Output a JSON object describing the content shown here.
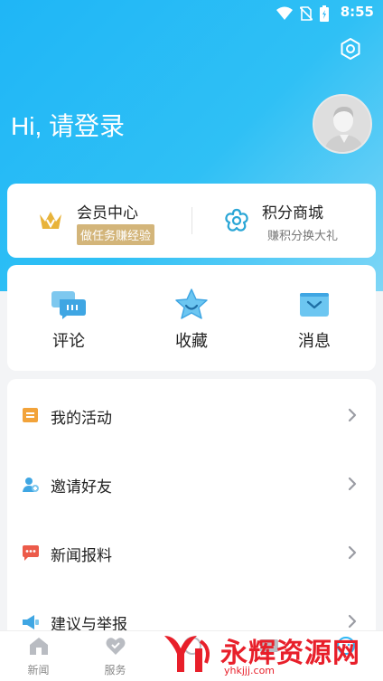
{
  "status_bar": {
    "time": "8:55"
  },
  "header": {
    "greeting": "Hi, 请登录"
  },
  "member": {
    "left_title": "会员中心",
    "left_badge": "做任务赚经验",
    "right_title": "积分商城",
    "right_sub": "赚积分换大礼"
  },
  "quick": [
    {
      "label": "评论",
      "icon": "comment-icon"
    },
    {
      "label": "收藏",
      "icon": "star-icon"
    },
    {
      "label": "消息",
      "icon": "mail-icon"
    }
  ],
  "menu": [
    {
      "label": "我的活动",
      "icon": "activity-icon"
    },
    {
      "label": "邀请好友",
      "icon": "invite-icon"
    },
    {
      "label": "新闻报料",
      "icon": "tipoff-icon"
    },
    {
      "label": "建议与举报",
      "icon": "report-icon"
    }
  ],
  "tabs": [
    {
      "label": "新闻",
      "icon": "home-icon"
    },
    {
      "label": "服务",
      "icon": "heart-icon"
    },
    {
      "label": "",
      "icon": "discover-icon"
    },
    {
      "label": "",
      "icon": "video-icon"
    },
    {
      "label": "",
      "icon": "profile-icon"
    }
  ],
  "watermark": {
    "text": "永辉资源网",
    "url": "yhkjjj.com"
  },
  "colors": {
    "header_gradient_start": "#1fb6f6",
    "header_gradient_end": "#7fd6f6",
    "vip_gold": "#d3b57a",
    "watermark_red": "#e81f2a"
  }
}
